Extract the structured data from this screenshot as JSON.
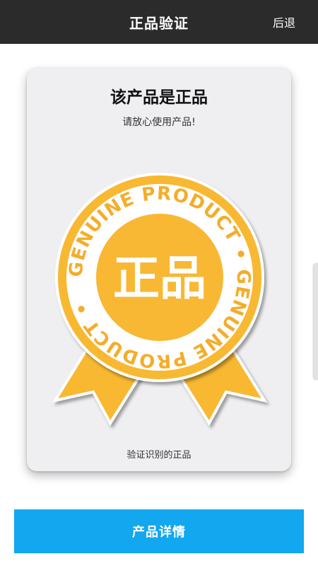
{
  "header": {
    "title": "正品验证",
    "back_label": "后退",
    "background": "#2b2b2b"
  },
  "result_card": {
    "title": "该产品是正品",
    "subtitle": "请放心使用产品!",
    "footer": "验证识别的正品",
    "seal": {
      "center_text": "正品",
      "ring_text": "GENUINE PRODUCT • GENUINE PRODUCT •",
      "color": "#f8b833"
    }
  },
  "detail_button": {
    "label": "产品详情",
    "color": "#12a7ef"
  }
}
